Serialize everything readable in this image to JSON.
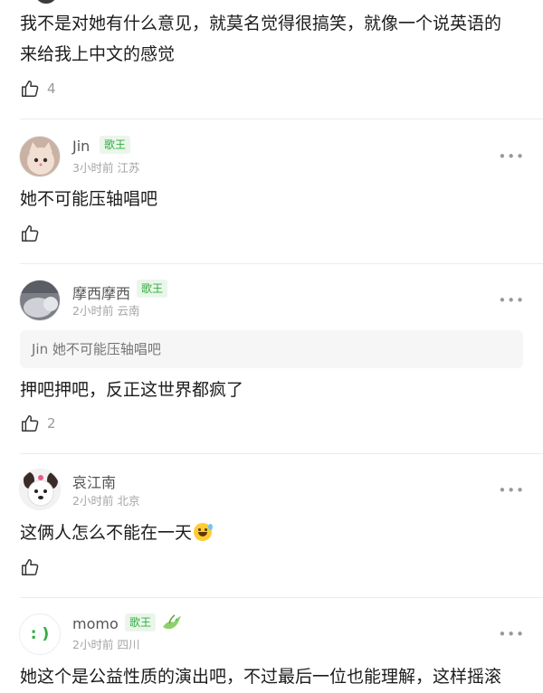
{
  "comments": [
    {
      "text_lines": [
        "我不是对她有什么意见，就莫名觉得很搞笑，就像一个说英语的",
        "来给我上中文的感觉"
      ],
      "likes": "4"
    },
    {
      "name": "Jin",
      "badge": "歌王",
      "time": "3小时前",
      "location": "江苏",
      "text": "她不可能压轴唱吧",
      "likes": ""
    },
    {
      "name": "摩西摩西",
      "badge": "歌王",
      "time": "2小时前",
      "location": "云南",
      "quote": "Jin 她不可能压轴唱吧",
      "text": "押吧押吧，反正这世界都疯了",
      "likes": "2"
    },
    {
      "name": "哀江南",
      "time": "2小时前",
      "location": "北京",
      "text": "这俩人怎么不能在一天",
      "likes": ""
    },
    {
      "name": "momo",
      "badge": "歌王",
      "time": "2小时前",
      "location": "四川",
      "avatar_text": ": )",
      "text": "她这个是公益性质的演出吧，不过最后一位也能理解，这样摇滚"
    }
  ],
  "icons": {
    "like": "thumbs-up-icon",
    "more": "more-dots-icon",
    "grin": "grinning-sweat-emoji",
    "bird": "bird-icon"
  },
  "colors": {
    "badge_text": "#2fae3f",
    "badge_bg": "#eaf6ea",
    "meta": "#a5a5a5"
  }
}
